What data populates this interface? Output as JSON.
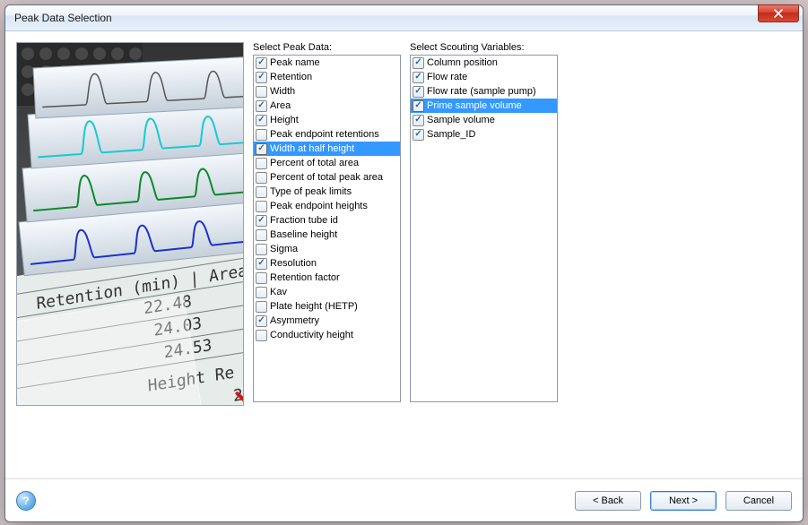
{
  "window": {
    "title": "Peak Data Selection"
  },
  "labels": {
    "peak_data": "Select Peak Data:",
    "scouting": "Select Scouting Variables:"
  },
  "buttons": {
    "back": "< Back",
    "next": "Next >",
    "cancel": "Cancel",
    "help_tooltip": "Help",
    "close_tooltip": "Close"
  },
  "peak_data_items": [
    {
      "label": "Peak name",
      "checked": true,
      "selected": false
    },
    {
      "label": "Retention",
      "checked": true,
      "selected": false
    },
    {
      "label": "Width",
      "checked": false,
      "selected": false
    },
    {
      "label": "Area",
      "checked": true,
      "selected": false
    },
    {
      "label": "Height",
      "checked": true,
      "selected": false
    },
    {
      "label": "Peak endpoint retentions",
      "checked": false,
      "selected": false
    },
    {
      "label": "Width at half height",
      "checked": true,
      "selected": true
    },
    {
      "label": "Percent of total area",
      "checked": false,
      "selected": false
    },
    {
      "label": "Percent of total peak area",
      "checked": false,
      "selected": false
    },
    {
      "label": "Type of peak limits",
      "checked": false,
      "selected": false
    },
    {
      "label": "Peak endpoint heights",
      "checked": false,
      "selected": false
    },
    {
      "label": "Fraction tube id",
      "checked": true,
      "selected": false
    },
    {
      "label": "Baseline height",
      "checked": false,
      "selected": false
    },
    {
      "label": "Sigma",
      "checked": false,
      "selected": false
    },
    {
      "label": "Resolution",
      "checked": true,
      "selected": false
    },
    {
      "label": "Retention factor",
      "checked": false,
      "selected": false
    },
    {
      "label": "Kav",
      "checked": false,
      "selected": false
    },
    {
      "label": "Plate height (HETP)",
      "checked": false,
      "selected": false
    },
    {
      "label": "Asymmetry",
      "checked": true,
      "selected": false
    },
    {
      "label": "Conductivity height",
      "checked": false,
      "selected": false
    }
  ],
  "scouting_items": [
    {
      "label": "Column position",
      "checked": true,
      "selected": false
    },
    {
      "label": "Flow rate",
      "checked": true,
      "selected": false
    },
    {
      "label": "Flow rate (sample pump)",
      "checked": true,
      "selected": false
    },
    {
      "label": "Prime sample volume",
      "checked": true,
      "selected": true
    },
    {
      "label": "Sample volume",
      "checked": true,
      "selected": false
    },
    {
      "label": "Sample_ID",
      "checked": true,
      "selected": false
    }
  ]
}
